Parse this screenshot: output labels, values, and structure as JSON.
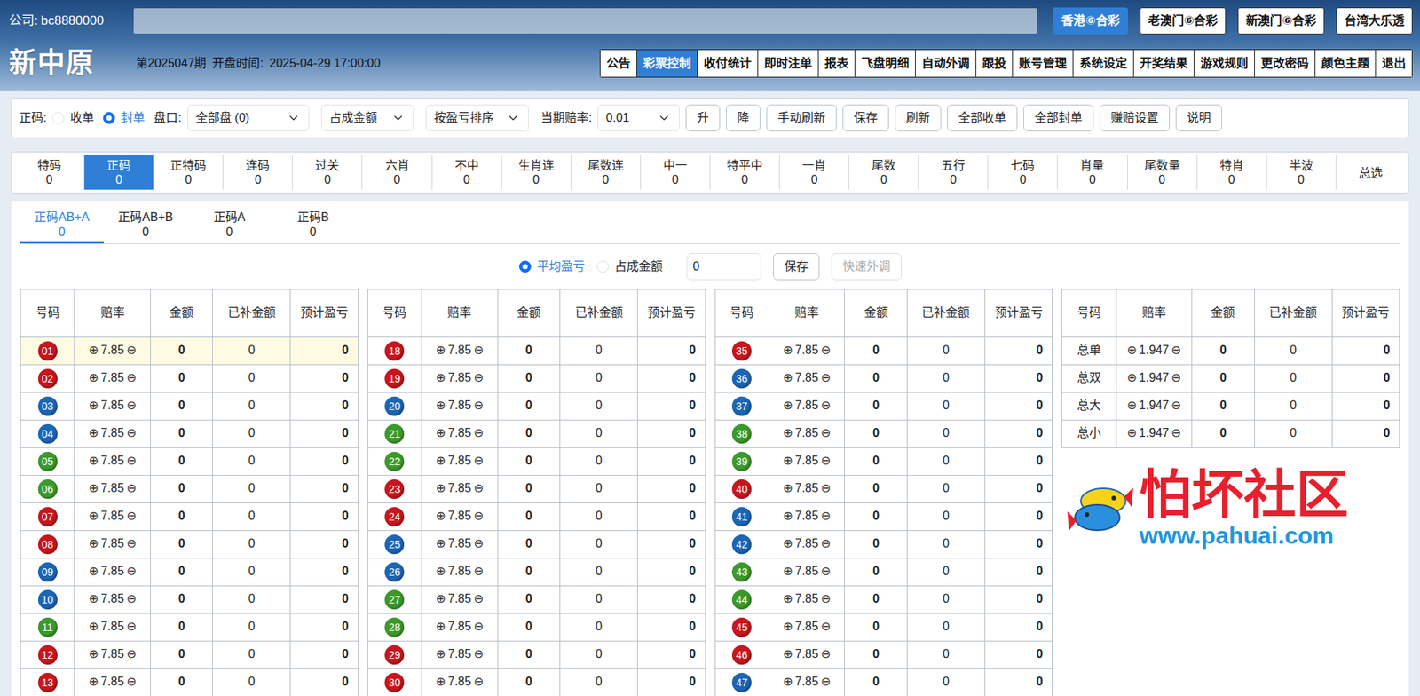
{
  "company": {
    "label": "公司:",
    "value": "bc8880000"
  },
  "lotteries": [
    {
      "label": "香港⑥合彩",
      "selected": true
    },
    {
      "label": "老澳门⑥合彩",
      "selected": false
    },
    {
      "label": "新澳门⑥合彩",
      "selected": false
    },
    {
      "label": "台湾大乐透",
      "selected": false
    }
  ],
  "brand": "新中原",
  "period": "第2025047期",
  "open_time": {
    "label": "开盘时间:",
    "value": "2025-04-29 17:00:00"
  },
  "nav": [
    {
      "label": "公告",
      "selected": false
    },
    {
      "label": "彩票控制",
      "selected": true
    },
    {
      "label": "收付统计",
      "selected": false
    },
    {
      "label": "即时注单",
      "selected": false
    },
    {
      "label": "报表",
      "selected": false
    },
    {
      "label": "飞盘明细",
      "selected": false
    },
    {
      "label": "自动外调",
      "selected": false
    },
    {
      "label": "跟投",
      "selected": false
    },
    {
      "label": "账号管理",
      "selected": false
    },
    {
      "label": "系统设定",
      "selected": false
    },
    {
      "label": "开奖结果",
      "selected": false
    },
    {
      "label": "游戏规则",
      "selected": false
    },
    {
      "label": "更改密码",
      "selected": false
    },
    {
      "label": "颜色主题",
      "selected": false
    },
    {
      "label": "退出",
      "selected": false
    }
  ],
  "toolbar": {
    "mode_label": "正码:",
    "modes": [
      {
        "label": "收单",
        "selected": false
      },
      {
        "label": "封单",
        "selected": true
      }
    ],
    "pan_label": "盘口:",
    "pan_value": "全部盘 (0)",
    "share_value": "占成金额",
    "sort_value": "按盈亏排序",
    "odds_label": "当期赔率:",
    "odds_value": "0.01",
    "buttons": [
      "升",
      "降",
      "手动刷新",
      "保存",
      "刷新",
      "全部收单",
      "全部封单",
      "赚赔设置",
      "说明"
    ]
  },
  "categories": [
    {
      "label": "特码",
      "count": "0",
      "selected": false
    },
    {
      "label": "正码",
      "count": "0",
      "selected": true
    },
    {
      "label": "正特码",
      "count": "0",
      "selected": false
    },
    {
      "label": "连码",
      "count": "0",
      "selected": false
    },
    {
      "label": "过关",
      "count": "0",
      "selected": false
    },
    {
      "label": "六肖",
      "count": "0",
      "selected": false
    },
    {
      "label": "不中",
      "count": "0",
      "selected": false
    },
    {
      "label": "生肖连",
      "count": "0",
      "selected": false
    },
    {
      "label": "尾数连",
      "count": "0",
      "selected": false
    },
    {
      "label": "中一",
      "count": "0",
      "selected": false
    },
    {
      "label": "特平中",
      "count": "0",
      "selected": false
    },
    {
      "label": "一肖",
      "count": "0",
      "selected": false
    },
    {
      "label": "尾数",
      "count": "0",
      "selected": false
    },
    {
      "label": "五行",
      "count": "0",
      "selected": false
    },
    {
      "label": "七码",
      "count": "0",
      "selected": false
    },
    {
      "label": "肖量",
      "count": "0",
      "selected": false
    },
    {
      "label": "尾数量",
      "count": "0",
      "selected": false
    },
    {
      "label": "特肖",
      "count": "0",
      "selected": false
    },
    {
      "label": "半波",
      "count": "0",
      "selected": false
    },
    {
      "label": "总选",
      "selected": false
    }
  ],
  "subtabs": [
    {
      "label": "正码AB+A",
      "count": "0",
      "selected": true
    },
    {
      "label": "正码AB+B",
      "count": "0",
      "selected": false
    },
    {
      "label": "正码A",
      "count": "0",
      "selected": false
    },
    {
      "label": "正码B",
      "count": "0",
      "selected": false
    }
  ],
  "adjust": {
    "options": [
      {
        "label": "平均盈亏",
        "selected": true
      },
      {
        "label": "占成金额",
        "selected": false
      }
    ],
    "value": "0",
    "buttons": [
      {
        "label": "保存",
        "disabled": false
      },
      {
        "label": "快速外调",
        "disabled": true
      }
    ]
  },
  "table": {
    "columns": [
      "号码",
      "赔率",
      "金额",
      "已补金额",
      "预计盈亏"
    ],
    "plus": "⊕",
    "minus": "⊖",
    "panels": [
      {
        "rows": [
          {
            "kind": "ball",
            "number": "01",
            "color": "#c8161e",
            "odds": "7.85",
            "amount": "0",
            "filled": "0",
            "profit": "0",
            "highlighted": true
          },
          {
            "kind": "ball",
            "number": "02",
            "color": "#c8161e",
            "odds": "7.85",
            "amount": "0",
            "filled": "0",
            "profit": "0",
            "highlighted": false
          },
          {
            "kind": "ball",
            "number": "03",
            "color": "#1b66b5",
            "odds": "7.85",
            "amount": "0",
            "filled": "0",
            "profit": "0",
            "highlighted": false
          },
          {
            "kind": "ball",
            "number": "04",
            "color": "#1b66b5",
            "odds": "7.85",
            "amount": "0",
            "filled": "0",
            "profit": "0",
            "highlighted": false
          },
          {
            "kind": "ball",
            "number": "05",
            "color": "#3b9a2b",
            "odds": "7.85",
            "amount": "0",
            "filled": "0",
            "profit": "0",
            "highlighted": false
          },
          {
            "kind": "ball",
            "number": "06",
            "color": "#3b9a2b",
            "odds": "7.85",
            "amount": "0",
            "filled": "0",
            "profit": "0",
            "highlighted": false
          },
          {
            "kind": "ball",
            "number": "07",
            "color": "#c8161e",
            "odds": "7.85",
            "amount": "0",
            "filled": "0",
            "profit": "0",
            "highlighted": false
          },
          {
            "kind": "ball",
            "number": "08",
            "color": "#c8161e",
            "odds": "7.85",
            "amount": "0",
            "filled": "0",
            "profit": "0",
            "highlighted": false
          },
          {
            "kind": "ball",
            "number": "09",
            "color": "#1b66b5",
            "odds": "7.85",
            "amount": "0",
            "filled": "0",
            "profit": "0",
            "highlighted": false
          },
          {
            "kind": "ball",
            "number": "10",
            "color": "#1b66b5",
            "odds": "7.85",
            "amount": "0",
            "filled": "0",
            "profit": "0",
            "highlighted": false
          },
          {
            "kind": "ball",
            "number": "11",
            "color": "#3b9a2b",
            "odds": "7.85",
            "amount": "0",
            "filled": "0",
            "profit": "0",
            "highlighted": false
          },
          {
            "kind": "ball",
            "number": "12",
            "color": "#c8161e",
            "odds": "7.85",
            "amount": "0",
            "filled": "0",
            "profit": "0",
            "highlighted": false
          },
          {
            "kind": "ball",
            "number": "13",
            "color": "#c8161e",
            "odds": "7.85",
            "amount": "0",
            "filled": "0",
            "profit": "0",
            "highlighted": false
          }
        ]
      },
      {
        "rows": [
          {
            "kind": "ball",
            "number": "18",
            "color": "#c8161e",
            "odds": "7.85",
            "amount": "0",
            "filled": "0",
            "profit": "0",
            "highlighted": false
          },
          {
            "kind": "ball",
            "number": "19",
            "color": "#c8161e",
            "odds": "7.85",
            "amount": "0",
            "filled": "0",
            "profit": "0",
            "highlighted": false
          },
          {
            "kind": "ball",
            "number": "20",
            "color": "#1b66b5",
            "odds": "7.85",
            "amount": "0",
            "filled": "0",
            "profit": "0",
            "highlighted": false
          },
          {
            "kind": "ball",
            "number": "21",
            "color": "#3b9a2b",
            "odds": "7.85",
            "amount": "0",
            "filled": "0",
            "profit": "0",
            "highlighted": false
          },
          {
            "kind": "ball",
            "number": "22",
            "color": "#3b9a2b",
            "odds": "7.85",
            "amount": "0",
            "filled": "0",
            "profit": "0",
            "highlighted": false
          },
          {
            "kind": "ball",
            "number": "23",
            "color": "#c8161e",
            "odds": "7.85",
            "amount": "0",
            "filled": "0",
            "profit": "0",
            "highlighted": false
          },
          {
            "kind": "ball",
            "number": "24",
            "color": "#c8161e",
            "odds": "7.85",
            "amount": "0",
            "filled": "0",
            "profit": "0",
            "highlighted": false
          },
          {
            "kind": "ball",
            "number": "25",
            "color": "#1b66b5",
            "odds": "7.85",
            "amount": "0",
            "filled": "0",
            "profit": "0",
            "highlighted": false
          },
          {
            "kind": "ball",
            "number": "26",
            "color": "#1b66b5",
            "odds": "7.85",
            "amount": "0",
            "filled": "0",
            "profit": "0",
            "highlighted": false
          },
          {
            "kind": "ball",
            "number": "27",
            "color": "#3b9a2b",
            "odds": "7.85",
            "amount": "0",
            "filled": "0",
            "profit": "0",
            "highlighted": false
          },
          {
            "kind": "ball",
            "number": "28",
            "color": "#3b9a2b",
            "odds": "7.85",
            "amount": "0",
            "filled": "0",
            "profit": "0",
            "highlighted": false
          },
          {
            "kind": "ball",
            "number": "29",
            "color": "#c8161e",
            "odds": "7.85",
            "amount": "0",
            "filled": "0",
            "profit": "0",
            "highlighted": false
          },
          {
            "kind": "ball",
            "number": "30",
            "color": "#c8161e",
            "odds": "7.85",
            "amount": "0",
            "filled": "0",
            "profit": "0",
            "highlighted": false
          }
        ]
      },
      {
        "rows": [
          {
            "kind": "ball",
            "number": "35",
            "color": "#c8161e",
            "odds": "7.85",
            "amount": "0",
            "filled": "0",
            "profit": "0",
            "highlighted": false
          },
          {
            "kind": "ball",
            "number": "36",
            "color": "#1b66b5",
            "odds": "7.85",
            "amount": "0",
            "filled": "0",
            "profit": "0",
            "highlighted": false
          },
          {
            "kind": "ball",
            "number": "37",
            "color": "#1b66b5",
            "odds": "7.85",
            "amount": "0",
            "filled": "0",
            "profit": "0",
            "highlighted": false
          },
          {
            "kind": "ball",
            "number": "38",
            "color": "#3b9a2b",
            "odds": "7.85",
            "amount": "0",
            "filled": "0",
            "profit": "0",
            "highlighted": false
          },
          {
            "kind": "ball",
            "number": "39",
            "color": "#3b9a2b",
            "odds": "7.85",
            "amount": "0",
            "filled": "0",
            "profit": "0",
            "highlighted": false
          },
          {
            "kind": "ball",
            "number": "40",
            "color": "#c8161e",
            "odds": "7.85",
            "amount": "0",
            "filled": "0",
            "profit": "0",
            "highlighted": false
          },
          {
            "kind": "ball",
            "number": "41",
            "color": "#1b66b5",
            "odds": "7.85",
            "amount": "0",
            "filled": "0",
            "profit": "0",
            "highlighted": false
          },
          {
            "kind": "ball",
            "number": "42",
            "color": "#1b66b5",
            "odds": "7.85",
            "amount": "0",
            "filled": "0",
            "profit": "0",
            "highlighted": false
          },
          {
            "kind": "ball",
            "number": "43",
            "color": "#3b9a2b",
            "odds": "7.85",
            "amount": "0",
            "filled": "0",
            "profit": "0",
            "highlighted": false
          },
          {
            "kind": "ball",
            "number": "44",
            "color": "#3b9a2b",
            "odds": "7.85",
            "amount": "0",
            "filled": "0",
            "profit": "0",
            "highlighted": false
          },
          {
            "kind": "ball",
            "number": "45",
            "color": "#c8161e",
            "odds": "7.85",
            "amount": "0",
            "filled": "0",
            "profit": "0",
            "highlighted": false
          },
          {
            "kind": "ball",
            "number": "46",
            "color": "#c8161e",
            "odds": "7.85",
            "amount": "0",
            "filled": "0",
            "profit": "0",
            "highlighted": false
          },
          {
            "kind": "ball",
            "number": "47",
            "color": "#1b66b5",
            "odds": "7.85",
            "amount": "0",
            "filled": "0",
            "profit": "0",
            "highlighted": false
          }
        ]
      },
      {
        "rows": [
          {
            "kind": "text",
            "number": "总单",
            "odds": "1.947",
            "amount": "0",
            "filled": "0",
            "profit": "0",
            "highlighted": false
          },
          {
            "kind": "text",
            "number": "总双",
            "odds": "1.947",
            "amount": "0",
            "filled": "0",
            "profit": "0",
            "highlighted": false
          },
          {
            "kind": "text",
            "number": "总大",
            "odds": "1.947",
            "amount": "0",
            "filled": "0",
            "profit": "0",
            "highlighted": false
          },
          {
            "kind": "text",
            "number": "总小",
            "odds": "1.947",
            "amount": "0",
            "filled": "0",
            "profit": "0",
            "highlighted": false
          }
        ]
      }
    ]
  },
  "watermark": {
    "name": "怕坏社区",
    "url": "www.pahuai.com"
  }
}
